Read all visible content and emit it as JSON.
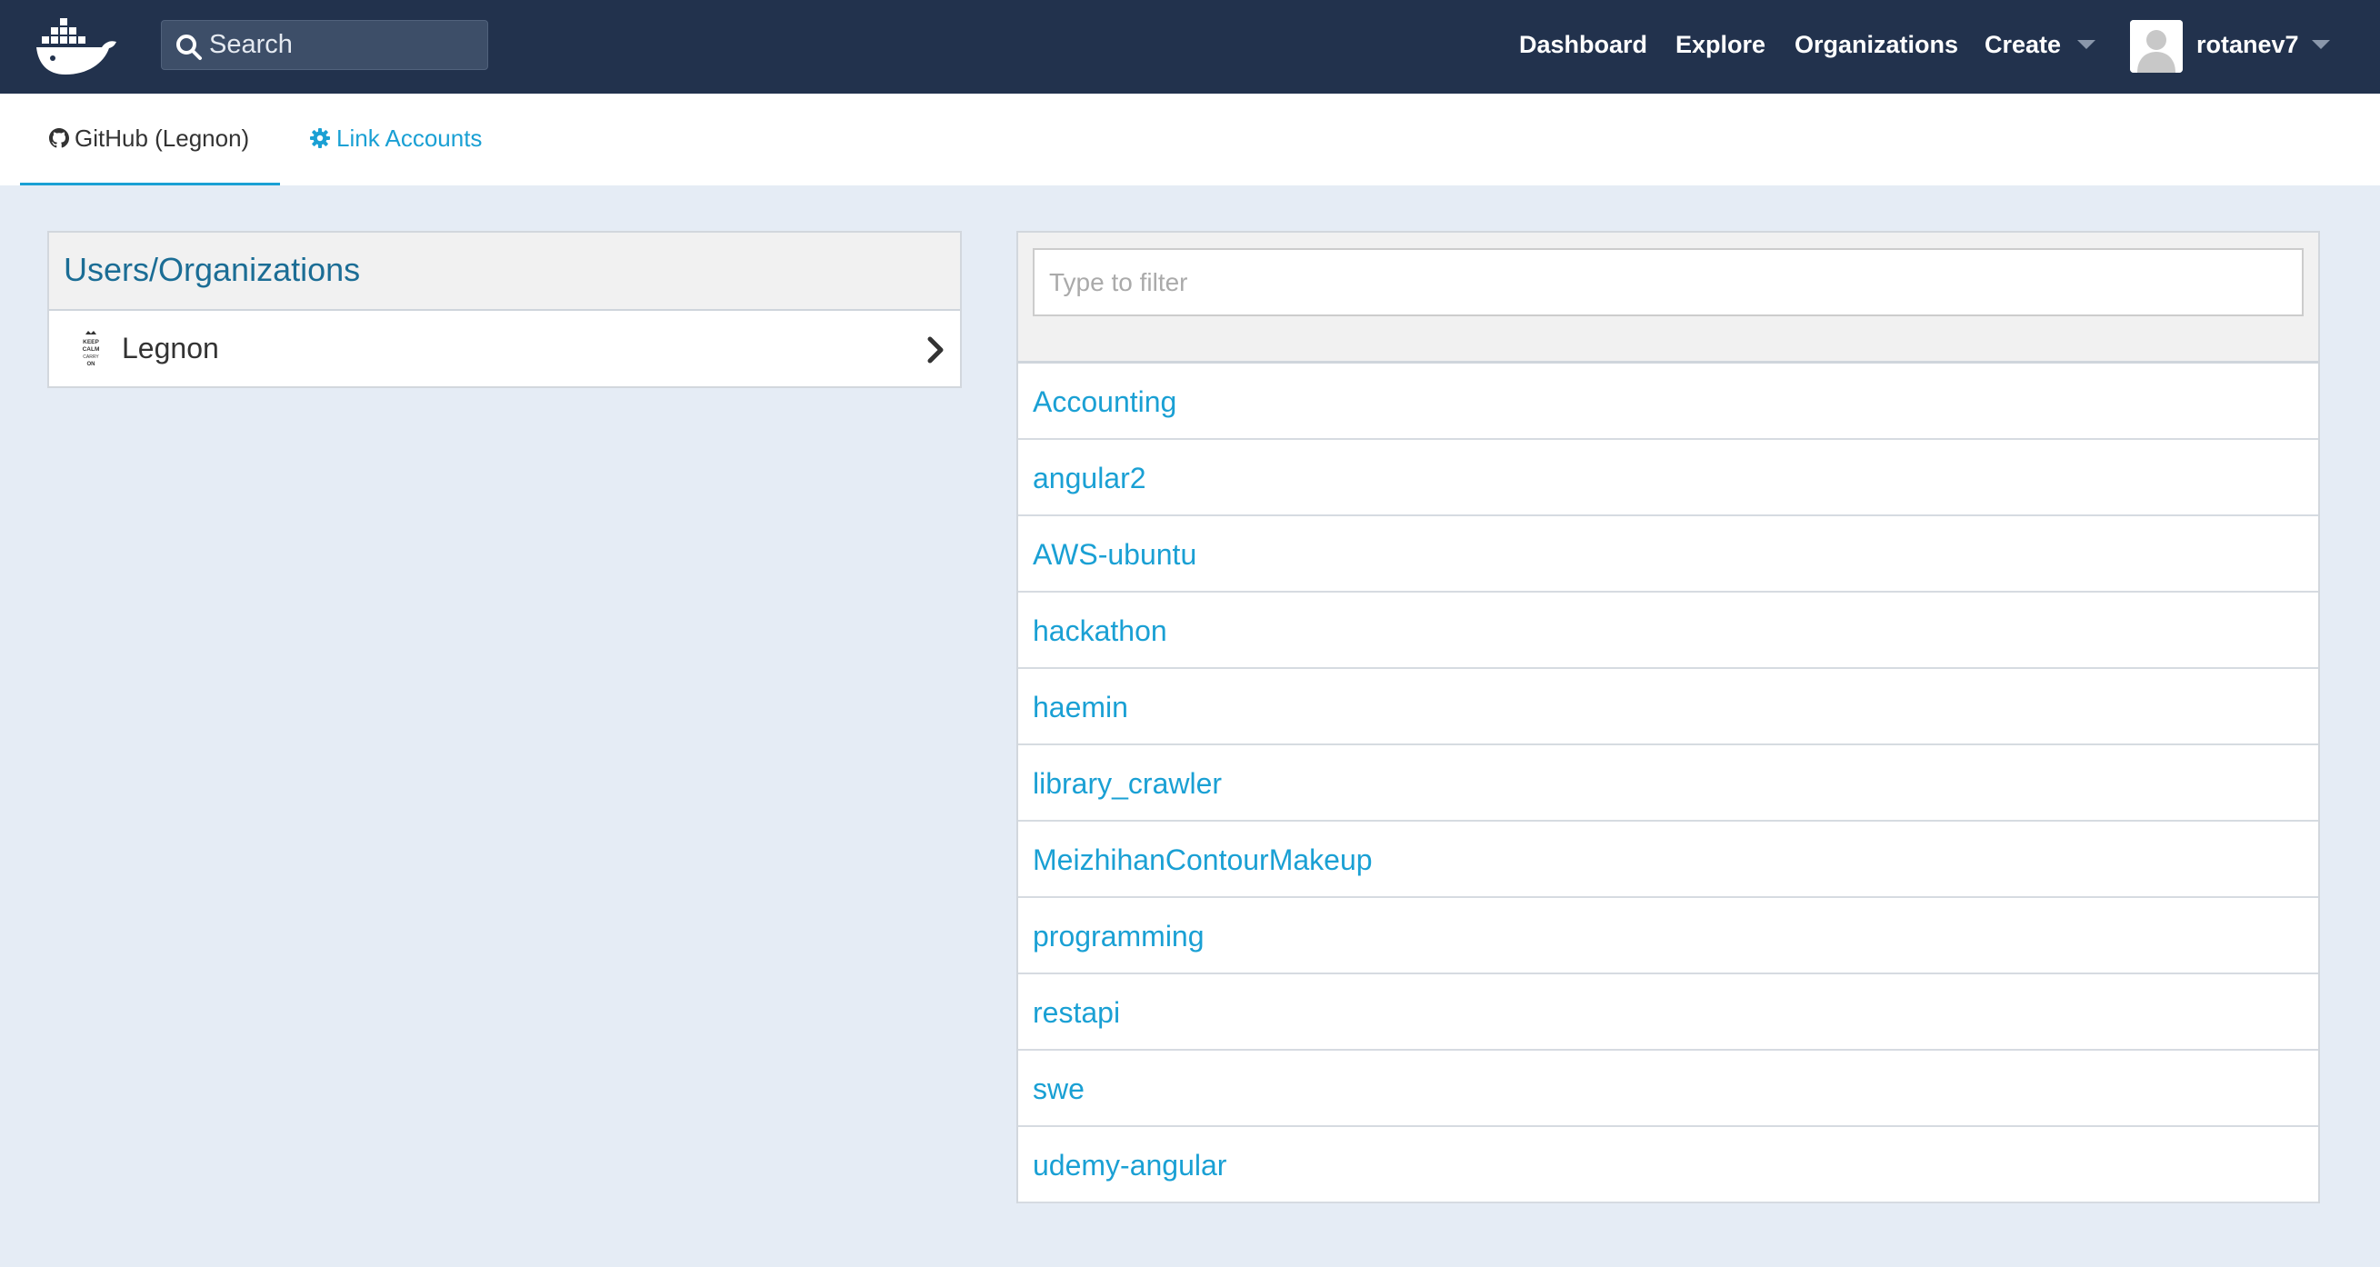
{
  "topnav": {
    "search_label": "Search",
    "links": {
      "dashboard": "Dashboard",
      "explore": "Explore",
      "organizations": "Organizations",
      "create": "Create"
    },
    "username": "rotanev7"
  },
  "subnav": {
    "github_tab": "GitHub (Legnon)",
    "link_accounts": "Link Accounts"
  },
  "users_panel": {
    "title": "Users/Organizations",
    "items": [
      {
        "name": "Legnon",
        "avatar_text": "KEEP CALM CARRY ON"
      }
    ]
  },
  "repo_panel": {
    "filter_placeholder": "Type to filter",
    "repos": [
      "Accounting",
      "angular2",
      "AWS-ubuntu",
      "hackathon",
      "haemin",
      "library_crawler",
      "MeizhihanContourMakeup",
      "programming",
      "restapi",
      "swe",
      "udemy-angular"
    ]
  },
  "colors": {
    "nav_bg": "#22324d",
    "page_bg": "#e5ecf5",
    "link_blue": "#1aa0d4",
    "panel_title": "#1b6d95"
  },
  "icons": {
    "logo": "docker-whale-logo",
    "search": "search-icon",
    "github": "github-icon",
    "gear": "gear-icon",
    "chevron": "chevron-right-icon",
    "caret": "caret-down-icon",
    "avatar": "user-avatar"
  }
}
